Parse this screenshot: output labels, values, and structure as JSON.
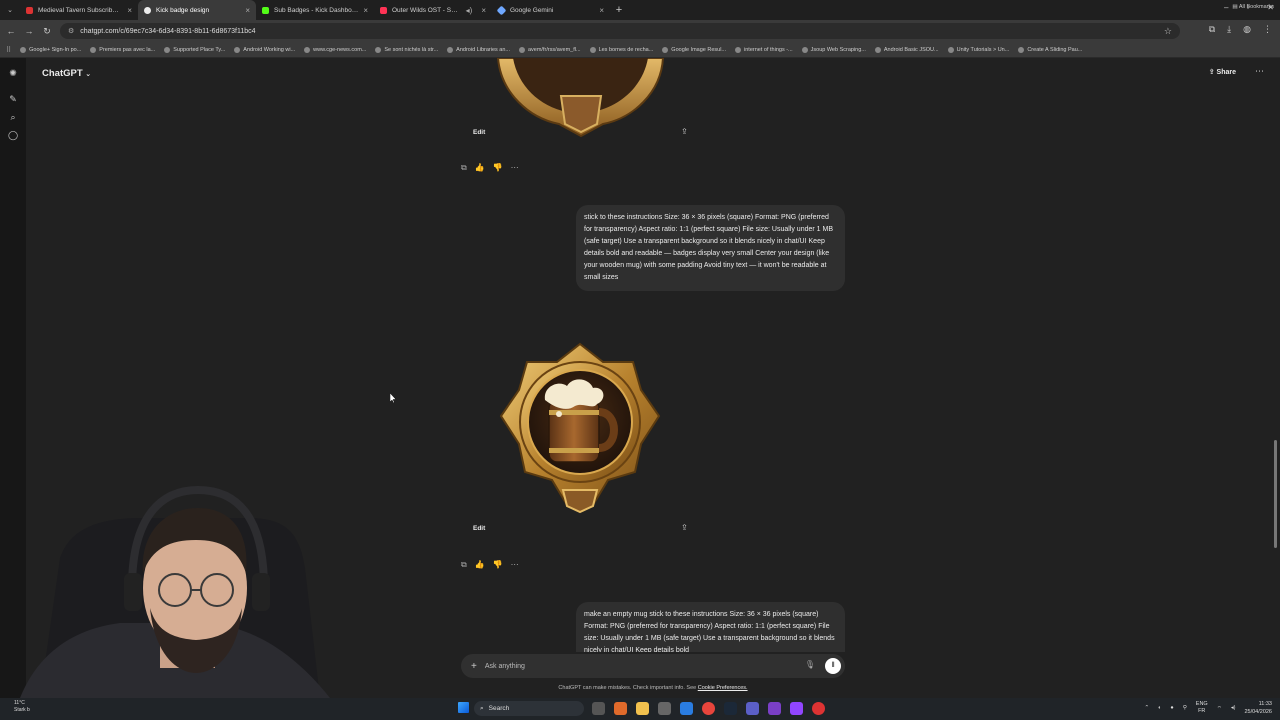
{
  "browser": {
    "tabs": [
      {
        "label": "Medieval Tavern Subscriber Ba...",
        "color": "#d33",
        "active": false
      },
      {
        "label": "Kick badge design",
        "color": "#ececec",
        "active": true
      },
      {
        "label": "Sub Badges - Kick Dashboard",
        "color": "#53fc18",
        "active": false
      },
      {
        "label": "Outer Wilds OST - Soundtr...",
        "color": "#ff3355",
        "active": false
      },
      {
        "label": "Google Gemini",
        "color": "#6fa8ff",
        "active": false
      }
    ],
    "url": "chatgpt.com/c/69ec7c34-6d34-8391-8b11-6d8673f11bc4",
    "bookmarks": [
      "Google+ Sign-In po...",
      "Premiers pas avec la...",
      "Supported Place Ty...",
      "Android Working wi...",
      "www.cge-news.com...",
      "Se sont nichés là str...",
      "Android Libraries an...",
      "avem/fr/rss/avem_fl...",
      "Les bornes de recha...",
      "Google Image Resul...",
      "internet of things -...",
      "Jsoup Web Scraping...",
      "Android Basic JSOU...",
      "Unity Tutorials > Un...",
      "Create A Sliding Pau..."
    ],
    "all_bookmarks": "All Bookmarks"
  },
  "chat": {
    "brand": "ChatGPT",
    "share_label": "Share",
    "image_edit_label": "Edit",
    "messages": [
      {
        "role": "user",
        "text": "stick to these instructions Size: 36 × 36 pixels (square) Format: PNG (preferred for transparency) Aspect ratio: 1:1 (perfect square) File size: Usually under 1 MB (safe target) Use a transparent background so it blends nicely in chat/UI Keep details bold and readable — badges display very small Center your design (like your wooden mug) with some padding Avoid tiny text — it won't be readable at small sizes"
      },
      {
        "role": "user",
        "text": "make an empty mug stick to these instructions Size: 36 × 36 pixels (square) Format: PNG (preferred for transparency) Aspect ratio: 1:1 (perfect square) File size: Usually under 1 MB (safe target) Use a transparent background so it blends nicely in chat/UI Keep details bold"
      }
    ],
    "composer_placeholder": "Ask anything",
    "disclaimer": "ChatGPT can make mistakes. Check important info. See",
    "disclaimer_link": "Cookie Preferences."
  },
  "taskbar": {
    "weather_temp": "11°C",
    "weather_label": "Stark b",
    "search_placeholder": "Search",
    "lang_top": "ENG",
    "lang_bottom": "FR",
    "time": "11:33",
    "date": "25/04/2026"
  }
}
